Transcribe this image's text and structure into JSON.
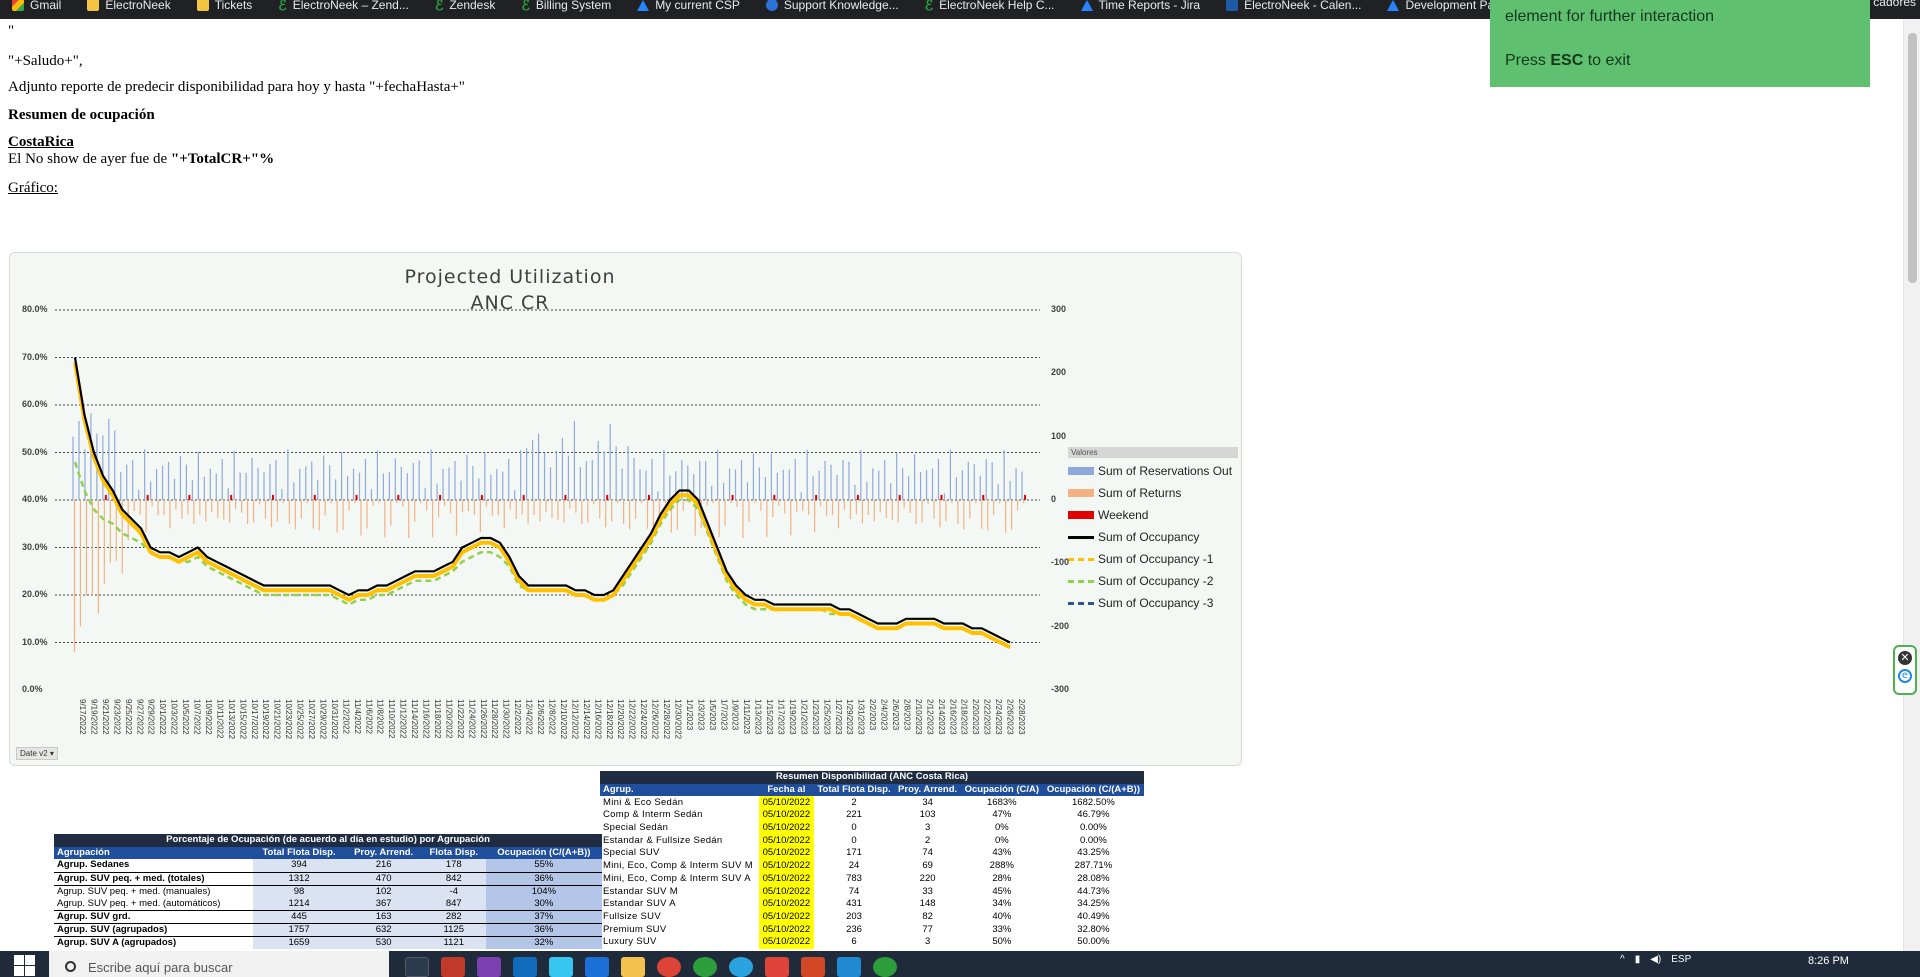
{
  "bookmarks": [
    {
      "label": "Gmail",
      "icon": "gmail-icon"
    },
    {
      "label": "ElectroNeek",
      "icon": "folder-icon"
    },
    {
      "label": "Tickets",
      "icon": "folder-icon"
    },
    {
      "label": "ElectroNeek – Zend...",
      "icon": "zendesk-icon"
    },
    {
      "label": "Zendesk",
      "icon": "zendesk-icon"
    },
    {
      "label": "Billing System",
      "icon": "zendesk-icon"
    },
    {
      "label": "My current CSP",
      "icon": "jira-icon"
    },
    {
      "label": "Support Knowledge...",
      "icon": "person-icon"
    },
    {
      "label": "ElectroNeek Help C...",
      "icon": "zendesk-icon"
    },
    {
      "label": "Time Reports - Jira",
      "icon": "jira-icon"
    },
    {
      "label": "ElectroNeek - Calen...",
      "icon": "calendar-icon"
    },
    {
      "label": "Development Packa...",
      "icon": "jira-icon"
    }
  ],
  "bookmarks_overflow": "cadores",
  "toast": {
    "line1": "element for further interaction",
    "line2_pre": "Press ",
    "line2_key": "ESC",
    "line2_post": " to exit"
  },
  "email": {
    "quote": "\"",
    "saludo": "\"+Saludo+\",",
    "intro": "Adjunto reporte de predecir disponibilidad para hoy y hasta \"+fechaHasta+\"",
    "section_title": "Resumen de ocupación",
    "country": "CostaRica",
    "noshow_pre": "El No show de ayer fue de ",
    "noshow_value": "\"+TotalCR+\"%",
    "grafico": "Gráfico:"
  },
  "chart_data": {
    "type": "line",
    "title": "Projected  Utilization",
    "subtitle": "ANC CR",
    "y_ticks": [
      "80.0%",
      "70.0%",
      "60.0%",
      "50.0%",
      "40.0%",
      "30.0%",
      "20.0%",
      "10.0%",
      "0.0%"
    ],
    "y2_ticks": [
      "300",
      "200",
      "100",
      "0",
      "-100",
      "-200",
      "-300"
    ],
    "ylim": [
      0,
      80
    ],
    "y2lim": [
      -300,
      300
    ],
    "x_labels": [
      "9/17/2022",
      "9/19/2022",
      "9/21/2022",
      "9/23/2022",
      "9/25/2022",
      "9/27/2022",
      "9/29/2022",
      "10/1/2022",
      "10/3/2022",
      "10/5/2022",
      "10/7/2022",
      "10/9/2022",
      "10/11/2022",
      "10/13/2022",
      "10/15/2022",
      "10/17/2022",
      "10/19/2022",
      "10/21/2022",
      "10/23/2022",
      "10/25/2022",
      "10/27/2022",
      "10/29/2022",
      "10/31/2022",
      "11/2/2022",
      "11/4/2022",
      "11/6/2022",
      "11/8/2022",
      "11/10/2022",
      "11/12/2022",
      "11/14/2022",
      "11/16/2022",
      "11/18/2022",
      "11/20/2022",
      "11/22/2022",
      "11/24/2022",
      "11/26/2022",
      "11/28/2022",
      "11/30/2022",
      "12/2/2022",
      "12/4/2022",
      "12/6/2022",
      "12/8/2022",
      "12/10/2022",
      "12/12/2022",
      "12/14/2022",
      "12/16/2022",
      "12/18/2022",
      "12/20/2022",
      "12/22/2022",
      "12/24/2022",
      "12/26/2022",
      "12/28/2022",
      "12/30/2022",
      "1/1/2023",
      "1/3/2023",
      "1/5/2023",
      "1/7/2023",
      "1/9/2023",
      "1/11/2023",
      "1/13/2023",
      "1/15/2023",
      "1/17/2023",
      "1/19/2023",
      "1/21/2023",
      "1/23/2023",
      "1/25/2023",
      "1/27/2023",
      "1/29/2023",
      "1/31/2023",
      "2/2/2023",
      "2/4/2023",
      "2/6/2023",
      "2/8/2023",
      "2/10/2023",
      "2/12/2023",
      "2/14/2023",
      "2/16/2023",
      "2/18/2023",
      "2/20/2023",
      "2/22/2023",
      "2/24/2023",
      "2/26/2023",
      "2/28/2023"
    ],
    "occupancy": [
      70,
      58,
      50,
      45,
      42,
      38,
      36,
      34,
      30,
      29,
      29,
      28,
      29,
      30,
      28,
      27,
      26,
      25,
      24,
      23,
      22,
      22,
      22,
      22,
      22,
      22,
      22,
      22,
      21,
      20,
      21,
      21,
      22,
      22,
      23,
      24,
      25,
      25,
      25,
      26,
      27,
      30,
      31,
      32,
      32,
      31,
      28,
      24,
      22,
      22,
      22,
      22,
      22,
      21,
      21,
      20,
      20,
      21,
      24,
      27,
      30,
      33,
      37,
      40,
      42,
      42,
      40,
      35,
      30,
      25,
      22,
      20,
      19,
      19,
      18,
      18,
      18,
      18,
      18,
      18,
      18,
      17,
      17,
      16,
      15,
      14,
      14,
      14,
      15,
      15,
      15,
      15,
      14,
      14,
      14,
      13,
      13,
      12,
      11,
      10
    ],
    "occupancy_m1": [
      69,
      57,
      49,
      44,
      41,
      37,
      35,
      33,
      29,
      28,
      28,
      27,
      28,
      29,
      27,
      26,
      25,
      24,
      23,
      22,
      21,
      21,
      21,
      21,
      21,
      21,
      21,
      21,
      20,
      19,
      20,
      20,
      21,
      21,
      22,
      23,
      24,
      24,
      24,
      25,
      26,
      29,
      30,
      31,
      31,
      30,
      27,
      23,
      21,
      21,
      21,
      21,
      21,
      20,
      20,
      19,
      19,
      20,
      23,
      26,
      29,
      32,
      36,
      39,
      41,
      41,
      39,
      34,
      29,
      24,
      21,
      19,
      18,
      18,
      17,
      17,
      17,
      17,
      17,
      17,
      17,
      16,
      16,
      15,
      14,
      13,
      13,
      13,
      14,
      14,
      14,
      14,
      13,
      13,
      13,
      12,
      12,
      11,
      10,
      9
    ],
    "occupancy_m2": [
      48,
      42,
      38,
      36,
      35,
      33,
      32,
      31,
      29,
      28,
      28,
      27,
      27,
      28,
      26,
      25,
      24,
      23,
      22,
      21,
      20,
      20,
      20,
      20,
      20,
      20,
      20,
      20,
      19,
      18,
      19,
      19,
      20,
      20,
      21,
      22,
      23,
      23,
      23,
      24,
      25,
      27,
      28,
      29,
      29,
      28,
      26,
      22,
      21,
      21,
      21,
      21,
      21,
      20,
      20,
      19,
      19,
      20,
      22,
      25,
      28,
      31,
      35,
      38,
      40,
      40,
      38,
      33,
      28,
      23,
      20,
      18,
      17,
      17,
      17,
      17,
      17,
      17,
      17,
      17,
      16,
      16,
      16,
      15,
      14,
      13,
      13,
      13,
      14,
      14,
      14,
      14,
      13,
      13,
      13,
      12,
      12,
      11,
      10,
      9
    ],
    "series": [
      {
        "name": "Sum of Reservations Out",
        "color": "#8fa8dc"
      },
      {
        "name": "Sum of Returns",
        "color": "#f4b183"
      },
      {
        "name": "Weekend",
        "color": "#e00000"
      },
      {
        "name": "Sum of Occupancy",
        "color": "#000000"
      },
      {
        "name": "Sum of Occupancy -1",
        "color": "#ffc000"
      },
      {
        "name": "Sum of Occupancy -2",
        "color": "#92d050"
      },
      {
        "name": "Sum of Occupancy -3",
        "color": "#2f5597"
      }
    ],
    "legend_title": "Valores",
    "legend_position": "right",
    "date_filter": "Date v2",
    "grid": true
  },
  "table_group": {
    "caption": "Porcentaje de Ocupación (de acuerdo al día en estudio) por Agrupación",
    "columns": [
      "Agrupación",
      "Total Flota Disp.",
      "Proy. Arrend.",
      "Flota Disp.",
      "Ocupación (C/(A+B))"
    ],
    "rows": [
      {
        "cells": [
          "Agrup. Sedanes",
          "394",
          "216",
          "178",
          "55%"
        ],
        "bold": true,
        "ul": true
      },
      {
        "cells": [
          "Agrup. SUV peq. + med. (totales)",
          "1312",
          "470",
          "842",
          "36%"
        ],
        "bold": true,
        "ul": true
      },
      {
        "cells": [
          "Agrup. SUV peq. + med. (manuales)",
          "98",
          "102",
          "-4",
          "104%"
        ],
        "bold": false,
        "ul": false
      },
      {
        "cells": [
          "Agrup. SUV peq. + med. (automáticos)",
          "1214",
          "367",
          "847",
          "30%"
        ],
        "bold": false,
        "ul": true
      },
      {
        "cells": [
          "Agrup. SUV grd.",
          "445",
          "163",
          "282",
          "37%"
        ],
        "bold": true,
        "ul": true
      },
      {
        "cells": [
          "Agrup. SUV (agrupados)",
          "1757",
          "632",
          "1125",
          "36%"
        ],
        "bold": true,
        "ul": true
      },
      {
        "cells": [
          "Agrup. SUV A (agrupados)",
          "1659",
          "530",
          "1121",
          "32%"
        ],
        "bold": true,
        "ul": false
      }
    ]
  },
  "table_summary": {
    "caption": "Resumen Disponibilidad (ANC Costa Rica)",
    "columns": [
      "Agrup.",
      "Fecha al",
      "Total Flota Disp.",
      "Proy. Arrend.",
      "Ocupación (C/A)",
      "Ocupación (C/(A+B))"
    ],
    "rows": [
      [
        "Mini & Eco Sedán",
        "05/10/2022",
        "2",
        "34",
        "1683%",
        "1682.50%"
      ],
      [
        "Comp & Interm Sedán",
        "05/10/2022",
        "221",
        "103",
        "47%",
        "46.79%"
      ],
      [
        "Special Sedán",
        "05/10/2022",
        "0",
        "3",
        "0%",
        "0.00%"
      ],
      [
        "Estandar & Fullsize Sedán",
        "05/10/2022",
        "0",
        "2",
        "0%",
        "0.00%"
      ],
      [
        "Special SUV",
        "05/10/2022",
        "171",
        "74",
        "43%",
        "43.25%"
      ],
      [
        "Mini, Eco, Comp & Interm SUV M",
        "05/10/2022",
        "24",
        "69",
        "288%",
        "287.71%"
      ],
      [
        "Mini, Eco, Comp & Interm SUV A",
        "05/10/2022",
        "783",
        "220",
        "28%",
        "28.08%"
      ],
      [
        "Estandar SUV M",
        "05/10/2022",
        "74",
        "33",
        "45%",
        "44.73%"
      ],
      [
        "Estandar SUV A",
        "05/10/2022",
        "431",
        "148",
        "34%",
        "34.25%"
      ],
      [
        "Fullsize SUV",
        "05/10/2022",
        "203",
        "82",
        "40%",
        "40.49%"
      ],
      [
        "Premium SUV",
        "05/10/2022",
        "236",
        "77",
        "33%",
        "32.80%"
      ],
      [
        "Luxury SUV",
        "05/10/2022",
        "6",
        "3",
        "50%",
        "50.00%"
      ]
    ]
  },
  "taskbar": {
    "search_placeholder": "Escribe aquí para buscar",
    "tray_lang": "ESP",
    "clock_time": "8:26 PM"
  }
}
